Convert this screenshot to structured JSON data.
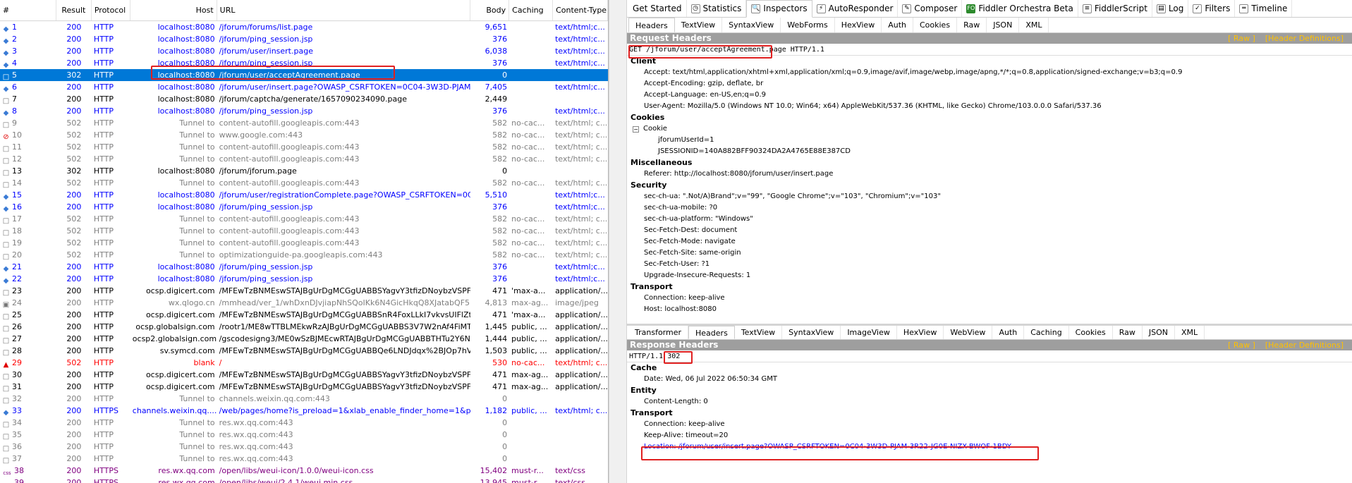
{
  "sessions": {
    "headers": [
      "#",
      "Result",
      "Protocol",
      "Host",
      "URL",
      "Body",
      "Caching",
      "Content-Type"
    ],
    "rows": [
      {
        "id": "1",
        "result": "200",
        "protocol": "HTTP",
        "host": "localhost:8080",
        "url": "/jforum/forums/list.page",
        "body": "9,651",
        "caching": "",
        "ctype": "text/html;c...",
        "color": "blue",
        "icon": "◆"
      },
      {
        "id": "2",
        "result": "200",
        "protocol": "HTTP",
        "host": "localhost:8080",
        "url": "/jforum/ping_session.jsp",
        "body": "376",
        "caching": "",
        "ctype": "text/html;c...",
        "color": "blue",
        "icon": "◆"
      },
      {
        "id": "3",
        "result": "200",
        "protocol": "HTTP",
        "host": "localhost:8080",
        "url": "/jforum/user/insert.page",
        "body": "6,038",
        "caching": "",
        "ctype": "text/html;c...",
        "color": "blue",
        "icon": "◆"
      },
      {
        "id": "4",
        "result": "200",
        "protocol": "HTTP",
        "host": "localhost:8080",
        "url": "/jforum/ping_session.jsp",
        "body": "376",
        "caching": "",
        "ctype": "text/html;c...",
        "color": "blue",
        "icon": "◆"
      },
      {
        "id": "5",
        "result": "302",
        "protocol": "HTTP",
        "host": "localhost:8080",
        "url": "/jforum/user/acceptAgreement.page",
        "body": "0",
        "caching": "",
        "ctype": "",
        "color": "black",
        "icon": "□",
        "selected": true
      },
      {
        "id": "6",
        "result": "200",
        "protocol": "HTTP",
        "host": "localhost:8080",
        "url": "/jforum/user/insert.page?OWASP_CSRFTOKEN=0C04-3W3D-PJAM-3R...",
        "body": "7,405",
        "caching": "",
        "ctype": "text/html;c...",
        "color": "blue",
        "icon": "◆"
      },
      {
        "id": "7",
        "result": "200",
        "protocol": "HTTP",
        "host": "localhost:8080",
        "url": "/jforum/captcha/generate/1657090234090.page",
        "body": "2,449",
        "caching": "",
        "ctype": "",
        "color": "black",
        "icon": "□"
      },
      {
        "id": "8",
        "result": "200",
        "protocol": "HTTP",
        "host": "localhost:8080",
        "url": "/jforum/ping_session.jsp",
        "body": "376",
        "caching": "",
        "ctype": "text/html;c...",
        "color": "blue",
        "icon": "◆"
      },
      {
        "id": "9",
        "result": "502",
        "protocol": "HTTP",
        "host": "Tunnel to",
        "url": "content-autofill.googleapis.com:443",
        "body": "582",
        "caching": "no-cac...",
        "ctype": "text/html; c...",
        "color": "gray",
        "icon": "□"
      },
      {
        "id": "10",
        "result": "502",
        "protocol": "HTTP",
        "host": "Tunnel to",
        "url": "www.google.com:443",
        "body": "582",
        "caching": "no-cac...",
        "ctype": "text/html; c...",
        "color": "gray",
        "icon": "⊘"
      },
      {
        "id": "11",
        "result": "502",
        "protocol": "HTTP",
        "host": "Tunnel to",
        "url": "content-autofill.googleapis.com:443",
        "body": "582",
        "caching": "no-cac...",
        "ctype": "text/html; c...",
        "color": "gray",
        "icon": "□"
      },
      {
        "id": "12",
        "result": "502",
        "protocol": "HTTP",
        "host": "Tunnel to",
        "url": "content-autofill.googleapis.com:443",
        "body": "582",
        "caching": "no-cac...",
        "ctype": "text/html; c...",
        "color": "gray",
        "icon": "□"
      },
      {
        "id": "13",
        "result": "302",
        "protocol": "HTTP",
        "host": "localhost:8080",
        "url": "/jforum/jforum.page",
        "body": "0",
        "caching": "",
        "ctype": "",
        "color": "black",
        "icon": "□"
      },
      {
        "id": "14",
        "result": "502",
        "protocol": "HTTP",
        "host": "Tunnel to",
        "url": "content-autofill.googleapis.com:443",
        "body": "582",
        "caching": "no-cac...",
        "ctype": "text/html; c...",
        "color": "gray",
        "icon": "□"
      },
      {
        "id": "15",
        "result": "200",
        "protocol": "HTTP",
        "host": "localhost:8080",
        "url": "/jforum/user/registrationComplete.page?OWASP_CSRFTOKEN=0C04-...",
        "body": "5,510",
        "caching": "",
        "ctype": "text/html;c...",
        "color": "blue",
        "icon": "◆"
      },
      {
        "id": "16",
        "result": "200",
        "protocol": "HTTP",
        "host": "localhost:8080",
        "url": "/jforum/ping_session.jsp",
        "body": "376",
        "caching": "",
        "ctype": "text/html;c...",
        "color": "blue",
        "icon": "◆"
      },
      {
        "id": "17",
        "result": "502",
        "protocol": "HTTP",
        "host": "Tunnel to",
        "url": "content-autofill.googleapis.com:443",
        "body": "582",
        "caching": "no-cac...",
        "ctype": "text/html; c...",
        "color": "gray",
        "icon": "□"
      },
      {
        "id": "18",
        "result": "502",
        "protocol": "HTTP",
        "host": "Tunnel to",
        "url": "content-autofill.googleapis.com:443",
        "body": "582",
        "caching": "no-cac...",
        "ctype": "text/html; c...",
        "color": "gray",
        "icon": "□"
      },
      {
        "id": "19",
        "result": "502",
        "protocol": "HTTP",
        "host": "Tunnel to",
        "url": "content-autofill.googleapis.com:443",
        "body": "582",
        "caching": "no-cac...",
        "ctype": "text/html; c...",
        "color": "gray",
        "icon": "□"
      },
      {
        "id": "20",
        "result": "502",
        "protocol": "HTTP",
        "host": "Tunnel to",
        "url": "optimizationguide-pa.googleapis.com:443",
        "body": "582",
        "caching": "no-cac...",
        "ctype": "text/html; c...",
        "color": "gray",
        "icon": "□"
      },
      {
        "id": "21",
        "result": "200",
        "protocol": "HTTP",
        "host": "localhost:8080",
        "url": "/jforum/ping_session.jsp",
        "body": "376",
        "caching": "",
        "ctype": "text/html;c...",
        "color": "blue",
        "icon": "◆"
      },
      {
        "id": "22",
        "result": "200",
        "protocol": "HTTP",
        "host": "localhost:8080",
        "url": "/jforum/ping_session.jsp",
        "body": "376",
        "caching": "",
        "ctype": "text/html;c...",
        "color": "blue",
        "icon": "◆"
      },
      {
        "id": "23",
        "result": "200",
        "protocol": "HTTP",
        "host": "ocsp.digicert.com",
        "url": "/MFEwTzBNMEswSTAJBgUrDgMCGgUABBSYagvY3tfizDNoybzVSPFZmS...",
        "body": "471",
        "caching": "'max-a...",
        "ctype": "application/...",
        "color": "black",
        "icon": "□"
      },
      {
        "id": "24",
        "result": "200",
        "protocol": "HTTP",
        "host": "wx.qlogo.cn",
        "url": "/mmhead/ver_1/whDxnDJvjiapNhSQoIKk6N4GicHkqQ8XJatabQF5pwJB...",
        "body": "4,813",
        "caching": "max-ag...",
        "ctype": "image/jpeg",
        "color": "gray",
        "icon": "▣"
      },
      {
        "id": "25",
        "result": "200",
        "protocol": "HTTP",
        "host": "ocsp.digicert.com",
        "url": "/MFEwTzBNMEswSTAJBgUrDgMCGgUABBSnR4FoxLLkI7vkvsUIFlZt%2B...",
        "body": "471",
        "caching": "'max-a...",
        "ctype": "application/...",
        "color": "black",
        "icon": "□"
      },
      {
        "id": "26",
        "result": "200",
        "protocol": "HTTP",
        "host": "ocsp.globalsign.com",
        "url": "/rootr1/ME8wTTBLMEkwRzAJBgUrDgMCGgUABBS3V7W2nAf4FiMTjpDJ...",
        "body": "1,445",
        "caching": "public, ...",
        "ctype": "application/...",
        "color": "black",
        "icon": "□"
      },
      {
        "id": "27",
        "result": "200",
        "protocol": "HTTP",
        "host": "ocsp2.globalsign.com",
        "url": "/gscodesigng3/ME0wSzBJMEcwRTAJBgUrDgMCGgUABBTHTu2Y6Nr%2...",
        "body": "1,444",
        "caching": "public, ...",
        "ctype": "application/...",
        "color": "black",
        "icon": "□"
      },
      {
        "id": "28",
        "result": "200",
        "protocol": "HTTP",
        "host": "sv.symcd.com",
        "url": "/MFEwTzBNMEswSTAJBgUrDgMCGgUABBQe6LNDJdqx%2BJOp7hVgTe...",
        "body": "1,503",
        "caching": "public, ...",
        "ctype": "application/...",
        "color": "black",
        "icon": "□"
      },
      {
        "id": "29",
        "result": "502",
        "protocol": "HTTP",
        "host": "blank",
        "url": "/",
        "body": "530",
        "caching": "no-cac...",
        "ctype": "text/html; c...",
        "color": "red",
        "icon": "▲"
      },
      {
        "id": "30",
        "result": "200",
        "protocol": "HTTP",
        "host": "ocsp.digicert.com",
        "url": "/MFEwTzBNMEswSTAJBgUrDgMCGgUABBSYagvY3tfizDNoybzVSPFZmS...",
        "body": "471",
        "caching": "max-ag...",
        "ctype": "application/...",
        "color": "black",
        "icon": "□"
      },
      {
        "id": "31",
        "result": "200",
        "protocol": "HTTP",
        "host": "ocsp.digicert.com",
        "url": "/MFEwTzBNMEswSTAJBgUrDgMCGgUABBSYagvY3tfizDNoybzVSPFZmS...",
        "body": "471",
        "caching": "max-ag...",
        "ctype": "application/...",
        "color": "black",
        "icon": "□"
      },
      {
        "id": "32",
        "result": "200",
        "protocol": "HTTP",
        "host": "Tunnel to",
        "url": "channels.weixin.qq.com:443",
        "body": "0",
        "caching": "",
        "ctype": "",
        "color": "gray",
        "icon": "□"
      },
      {
        "id": "33",
        "result": "200",
        "protocol": "HTTPS",
        "host": "channels.weixin.qq....",
        "url": "/web/pages/home?is_preload=1&xlab_enable_finder_home=1&preloa...",
        "body": "1,182",
        "caching": "public, ...",
        "ctype": "text/html; c...",
        "color": "blue",
        "icon": "◆"
      },
      {
        "id": "34",
        "result": "200",
        "protocol": "HTTP",
        "host": "Tunnel to",
        "url": "res.wx.qq.com:443",
        "body": "0",
        "caching": "",
        "ctype": "",
        "color": "gray",
        "icon": "□"
      },
      {
        "id": "35",
        "result": "200",
        "protocol": "HTTP",
        "host": "Tunnel to",
        "url": "res.wx.qq.com:443",
        "body": "0",
        "caching": "",
        "ctype": "",
        "color": "gray",
        "icon": "□"
      },
      {
        "id": "36",
        "result": "200",
        "protocol": "HTTP",
        "host": "Tunnel to",
        "url": "res.wx.qq.com:443",
        "body": "0",
        "caching": "",
        "ctype": "",
        "color": "gray",
        "icon": "□"
      },
      {
        "id": "37",
        "result": "200",
        "protocol": "HTTP",
        "host": "Tunnel to",
        "url": "res.wx.qq.com:443",
        "body": "0",
        "caching": "",
        "ctype": "",
        "color": "gray",
        "icon": "□"
      },
      {
        "id": "38",
        "result": "200",
        "protocol": "HTTPS",
        "host": "res.wx.qq.com",
        "url": "/open/libs/weui-icon/1.0.0/weui-icon.css",
        "body": "15,402",
        "caching": "must-r...",
        "ctype": "text/css",
        "color": "purple",
        "icon": "css"
      },
      {
        "id": "39",
        "result": "200",
        "protocol": "HTTPS",
        "host": "res.wx.qq.com",
        "url": "/open/libs/weui/2.4.1/weui.min.css",
        "body": "13,945",
        "caching": "must-r...",
        "ctype": "text/css",
        "color": "purple",
        "icon": "css"
      }
    ]
  },
  "tabs_top": [
    {
      "label": "Get Started",
      "icon": ""
    },
    {
      "label": "Statistics",
      "icon": "◷"
    },
    {
      "label": "Inspectors",
      "icon": "🔍",
      "active": true
    },
    {
      "label": "AutoResponder",
      "icon": "⚡"
    },
    {
      "label": "Composer",
      "icon": "✎"
    },
    {
      "label": "Fiddler Orchestra Beta",
      "icon": "FO"
    },
    {
      "label": "FiddlerScript",
      "icon": "≡"
    },
    {
      "label": "Log",
      "icon": "▤"
    },
    {
      "label": "Filters",
      "icon": "✓"
    },
    {
      "label": "Timeline",
      "icon": "═"
    }
  ],
  "tabs_request": [
    "Headers",
    "TextView",
    "SyntaxView",
    "WebForms",
    "HexView",
    "Auth",
    "Cookies",
    "Raw",
    "JSON",
    "XML"
  ],
  "request": {
    "title": "Request Headers",
    "raw_link": "[ Raw ]",
    "defs_link": "[Header Definitions]",
    "line": "GET /jforum/user/acceptAgreement.page HTTP/1.1",
    "client_label": "Client",
    "accept": "Accept: text/html,application/xhtml+xml,application/xml;q=0.9,image/avif,image/webp,image/apng,*/*;q=0.8,application/signed-exchange;v=b3;q=0.9",
    "accept_encoding": "Accept-Encoding: gzip, deflate, br",
    "accept_language": "Accept-Language: en-US,en;q=0.9",
    "user_agent": "User-Agent: Mozilla/5.0 (Windows NT 10.0; Win64; x64) AppleWebKit/537.36 (KHTML, like Gecko) Chrome/103.0.0.0 Safari/537.36",
    "cookies_label": "Cookies",
    "cookie_node": "Cookie",
    "cookie_user": "jforumUserId=1",
    "cookie_session": "JSESSIONID=140A882BFF90324DA2A4765E88E387CD",
    "misc_label": "Miscellaneous",
    "referer": "Referer: http://localhost:8080/jforum/user/insert.page",
    "security_label": "Security",
    "sec_ch_ua": "sec-ch-ua: \".Not/A)Brand\";v=\"99\", \"Google Chrome\";v=\"103\", \"Chromium\";v=\"103\"",
    "sec_ch_ua_mobile": "sec-ch-ua-mobile: ?0",
    "sec_ch_ua_platform": "sec-ch-ua-platform: \"Windows\"",
    "sec_fetch_dest": "Sec-Fetch-Dest: document",
    "sec_fetch_mode": "Sec-Fetch-Mode: navigate",
    "sec_fetch_site": "Sec-Fetch-Site: same-origin",
    "sec_fetch_user": "Sec-Fetch-User: ?1",
    "upgrade": "Upgrade-Insecure-Requests: 1",
    "transport_label": "Transport",
    "connection": "Connection: keep-alive",
    "host": "Host: localhost:8080"
  },
  "tabs_response": [
    "Transformer",
    "Headers",
    "TextView",
    "SyntaxView",
    "ImageView",
    "HexView",
    "WebView",
    "Auth",
    "Caching",
    "Cookies",
    "Raw",
    "JSON",
    "XML"
  ],
  "response": {
    "title": "Response Headers",
    "raw_link": "[ Raw ]",
    "defs_link": "[Header Definitions]",
    "line_prefix": "HTTP/1.1",
    "status": "302",
    "cache_label": "Cache",
    "date": "Date: Wed, 06 Jul 2022 06:50:34 GMT",
    "entity_label": "Entity",
    "content_length": "Content-Length: 0",
    "transport_label": "Transport",
    "connection": "Connection: keep-alive",
    "keep_alive": "Keep-Alive: timeout=20",
    "location": "Location: /jforum/user/insert.page?OWASP_CSRFTOKEN=0C04-3W3D-PJAM-3R22-JG0E-NIZX-BWOF-1BDY"
  },
  "colors": {
    "blue": "#0000ff",
    "gray": "#808080",
    "red": "#ff0000",
    "purple": "#800080",
    "selection": "#0078d7",
    "highlight": "#e02020",
    "section": "#9e9e9e",
    "link": "#ffc000"
  }
}
